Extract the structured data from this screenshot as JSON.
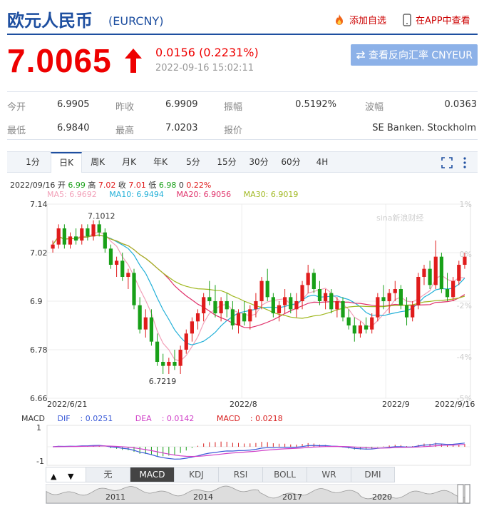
{
  "header": {
    "title": "欧元人民币",
    "code": "(EURCNY)",
    "add_watch": "添加自选",
    "view_app": "在APP中查看"
  },
  "quote": {
    "price": "7.0065",
    "change": "0.0156 (0.2231%)",
    "time": "2022-09-16 15:02:11",
    "reverse_btn": "查看反向汇率 CNYEUR"
  },
  "stats": [
    {
      "label": "今开",
      "value": "6.9905"
    },
    {
      "label": "昨收",
      "value": "6.9909"
    },
    {
      "label": "振幅",
      "value": "0.5192%"
    },
    {
      "label": "波幅",
      "value": "0.0363"
    },
    {
      "label": "最低",
      "value": "6.9840"
    },
    {
      "label": "最高",
      "value": "7.0203"
    },
    {
      "label": "报价",
      "value": "SE Banken. Stockholm"
    }
  ],
  "tabs": [
    "1分",
    "日K",
    "周K",
    "月K",
    "年K",
    "5分",
    "15分",
    "30分",
    "60分",
    "4H"
  ],
  "active_tab": "日K",
  "ohlc_info": {
    "date": "2022/09/16",
    "open_label": "开",
    "open": "6.99",
    "high_label": "高",
    "high": "7.02",
    "close_label": "收",
    "close": "7.01",
    "low_label": "低",
    "low": "6.98",
    "vol": "0",
    "pct": "0.22%"
  },
  "ma_info": [
    {
      "text": "MA5: 6.9692",
      "color": "#f2a0b8"
    },
    {
      "text": "MA10: 6.9494",
      "color": "#22b0d8"
    },
    {
      "text": "MA20: 6.9056",
      "color": "#e0306a"
    },
    {
      "text": "MA30: 6.9019",
      "color": "#a0b820"
    }
  ],
  "watermark": "sina新浪财经",
  "chart_data": {
    "type": "candlestick",
    "y_ticks": [
      "7.14",
      "7.02",
      "6.9",
      "6.78",
      "6.66"
    ],
    "ylim": [
      6.66,
      7.14
    ],
    "pct_ticks": [
      "1%",
      "0%",
      "-2%",
      "-4%",
      "-5%"
    ],
    "x_ticks": [
      "2022/6/21",
      "2022/8",
      "2022/9",
      "2022/9/16"
    ],
    "annotations": [
      "7.1012",
      "6.7219"
    ],
    "up_color": "#e01c1c",
    "down_color": "#18a018",
    "candles": [
      [
        7.03,
        7.05,
        7.02,
        7.04
      ],
      [
        7.04,
        7.09,
        7.03,
        7.08
      ],
      [
        7.08,
        7.09,
        7.03,
        7.04
      ],
      [
        7.04,
        7.07,
        7.03,
        7.06
      ],
      [
        7.06,
        7.08,
        7.04,
        7.05
      ],
      [
        7.05,
        7.09,
        7.04,
        7.08
      ],
      [
        7.08,
        7.09,
        7.05,
        7.06
      ],
      [
        7.06,
        7.1,
        7.05,
        7.09
      ],
      [
        7.09,
        7.1,
        7.06,
        7.07
      ],
      [
        7.07,
        7.08,
        7.02,
        7.03
      ],
      [
        7.03,
        7.04,
        6.98,
        6.99
      ],
      [
        6.99,
        7.01,
        6.96,
        7.0
      ],
      [
        7.0,
        7.02,
        6.95,
        6.96
      ],
      [
        6.96,
        6.98,
        6.93,
        6.97
      ],
      [
        6.97,
        6.98,
        6.88,
        6.89
      ],
      [
        6.89,
        6.91,
        6.82,
        6.83
      ],
      [
        6.83,
        6.88,
        6.81,
        6.86
      ],
      [
        6.86,
        6.88,
        6.79,
        6.8
      ],
      [
        6.8,
        6.82,
        6.74,
        6.75
      ],
      [
        6.75,
        6.77,
        6.72,
        6.74
      ],
      [
        6.74,
        6.76,
        6.72,
        6.75
      ],
      [
        6.75,
        6.78,
        6.73,
        6.74
      ],
      [
        6.74,
        6.79,
        6.72,
        6.78
      ],
      [
        6.78,
        6.83,
        6.77,
        6.82
      ],
      [
        6.82,
        6.86,
        6.8,
        6.85
      ],
      [
        6.85,
        6.88,
        6.83,
        6.87
      ],
      [
        6.87,
        6.92,
        6.85,
        6.91
      ],
      [
        6.91,
        6.95,
        6.89,
        6.9
      ],
      [
        6.9,
        6.94,
        6.86,
        6.87
      ],
      [
        6.87,
        6.91,
        6.85,
        6.9
      ],
      [
        6.9,
        6.92,
        6.86,
        6.88
      ],
      [
        6.88,
        6.9,
        6.83,
        6.84
      ],
      [
        6.84,
        6.88,
        6.82,
        6.87
      ],
      [
        6.87,
        6.9,
        6.84,
        6.85
      ],
      [
        6.85,
        6.89,
        6.83,
        6.88
      ],
      [
        6.88,
        6.92,
        6.86,
        6.9
      ],
      [
        6.9,
        6.96,
        6.88,
        6.95
      ],
      [
        6.95,
        6.98,
        6.9,
        6.91
      ],
      [
        6.91,
        6.92,
        6.86,
        6.87
      ],
      [
        6.87,
        6.9,
        6.85,
        6.89
      ],
      [
        6.89,
        6.93,
        6.87,
        6.91
      ],
      [
        6.91,
        6.92,
        6.87,
        6.88
      ],
      [
        6.88,
        6.92,
        6.86,
        6.9
      ],
      [
        6.9,
        6.95,
        6.88,
        6.94
      ],
      [
        6.94,
        6.99,
        6.92,
        6.97
      ],
      [
        6.97,
        6.98,
        6.92,
        6.93
      ],
      [
        6.93,
        6.95,
        6.89,
        6.9
      ],
      [
        6.9,
        6.93,
        6.88,
        6.92
      ],
      [
        6.92,
        6.93,
        6.87,
        6.88
      ],
      [
        6.88,
        6.91,
        6.86,
        6.9
      ],
      [
        6.9,
        6.91,
        6.85,
        6.86
      ],
      [
        6.86,
        6.88,
        6.83,
        6.84
      ],
      [
        6.84,
        6.86,
        6.8,
        6.82
      ],
      [
        6.82,
        6.85,
        6.81,
        6.84
      ],
      [
        6.84,
        6.86,
        6.82,
        6.83
      ],
      [
        6.83,
        6.87,
        6.82,
        6.86
      ],
      [
        6.86,
        6.92,
        6.85,
        6.91
      ],
      [
        6.91,
        6.94,
        6.88,
        6.9
      ],
      [
        6.9,
        6.93,
        6.87,
        6.92
      ],
      [
        6.92,
        6.95,
        6.9,
        6.93
      ],
      [
        6.93,
        6.94,
        6.88,
        6.89
      ],
      [
        6.89,
        6.91,
        6.84,
        6.86
      ],
      [
        6.86,
        6.9,
        6.85,
        6.89
      ],
      [
        6.89,
        6.97,
        6.88,
        6.96
      ],
      [
        6.96,
        6.99,
        6.94,
        6.98
      ],
      [
        6.98,
        7.0,
        6.93,
        6.94
      ],
      [
        6.94,
        7.05,
        6.93,
        7.01
      ],
      [
        7.01,
        7.02,
        6.92,
        6.93
      ],
      [
        6.93,
        6.97,
        6.9,
        6.91
      ],
      [
        6.91,
        6.96,
        6.9,
        6.95
      ],
      [
        6.95,
        7.0,
        6.94,
        6.99
      ],
      [
        6.99,
        7.02,
        6.98,
        7.01
      ]
    ],
    "macd": {
      "ylim_labels": [
        "1",
        "-1"
      ],
      "dif": "0.0251",
      "dea": "0.0142",
      "macd": "0.0218",
      "dif_label": "DIF",
      "dea_label": "DEA",
      "macd_label": "MACD",
      "dif_color": "#3b5bd8",
      "dea_color": "#d040c8",
      "macd_color": "#d82020"
    }
  },
  "macd_title": "MACD",
  "indicator_tabs": [
    "无",
    "MACD",
    "KDJ",
    "RSI",
    "BOLL",
    "WR",
    "DMI"
  ],
  "active_indicator": "MACD",
  "nav": {
    "up": "▲",
    "down": "▼"
  },
  "timeline_years": [
    "2011",
    "2014",
    "2017",
    "2020"
  ]
}
